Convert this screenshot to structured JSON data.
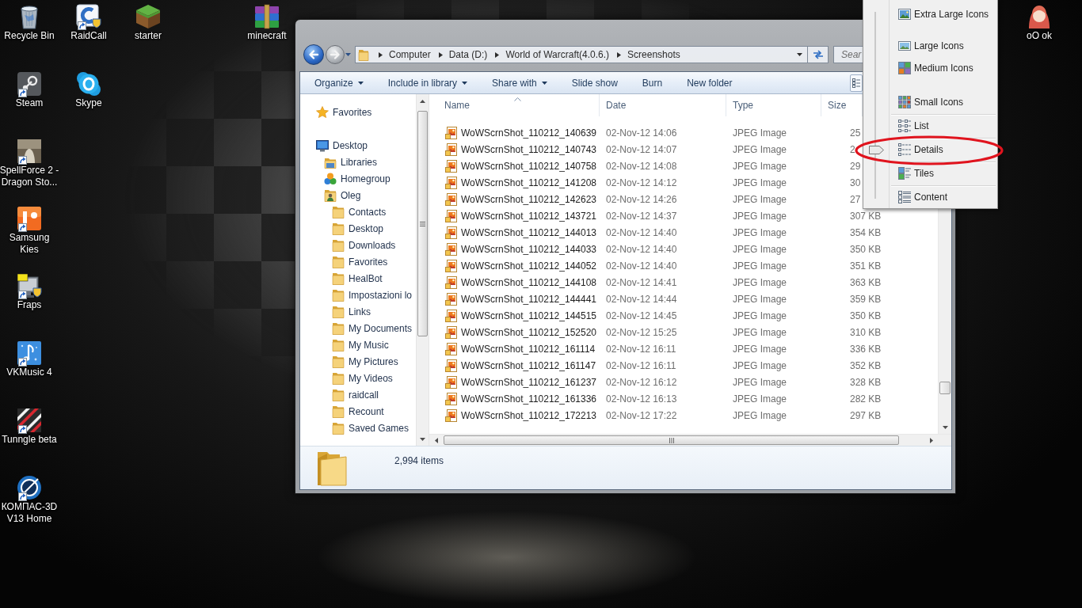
{
  "desktop_icons": [
    {
      "label": "Recycle Bin",
      "shortcut": false
    },
    {
      "label": "RaidCall",
      "shortcut": true
    },
    {
      "label": "starter",
      "shortcut": false
    },
    {
      "label": "minecraft",
      "shortcut": false
    },
    {
      "label": "oO ok",
      "shortcut": false
    },
    {
      "label": "Steam",
      "shortcut": true
    },
    {
      "label": "Skype",
      "shortcut": false
    },
    {
      "label": "SpellForce 2 - Dragon Sto...",
      "shortcut": true
    },
    {
      "label": "Samsung Kies",
      "shortcut": true
    },
    {
      "label": "Fraps",
      "shortcut": true
    },
    {
      "label": "VKMusic 4",
      "shortcut": true
    },
    {
      "label": "Tunngle beta",
      "shortcut": true
    },
    {
      "label": "КОМПАС-3D V13 Home",
      "shortcut": true
    }
  ],
  "explorer": {
    "nav_buttons": [
      {
        "kind": "back",
        "disabled": false
      },
      {
        "kind": "forward",
        "disabled": true
      }
    ],
    "address_bar": {
      "path": [
        "Computer",
        "Data (D:)",
        "World of Warcraft(4.0.6.)",
        "Screenshots"
      ]
    },
    "search": {
      "placeholder": "Sear"
    },
    "toolbar": [
      {
        "label": "Organize",
        "menu": true
      },
      {
        "label": "Include in library",
        "menu": true
      },
      {
        "label": "Share with",
        "menu": true
      },
      {
        "label": "Slide show",
        "menu": false
      },
      {
        "label": "Burn",
        "menu": false
      },
      {
        "label": "New folder",
        "menu": false
      }
    ],
    "nav_pane": [
      {
        "label": "Favorites",
        "kind": "favorites"
      },
      {
        "label": "Desktop",
        "kind": "desktop",
        "children": [
          {
            "label": "Libraries",
            "kind": "libraries"
          },
          {
            "label": "Homegroup",
            "kind": "homegroup"
          },
          {
            "label": "Oleg",
            "kind": "user",
            "children": [
              {
                "label": "Contacts",
                "kind": "folder"
              },
              {
                "label": "Desktop",
                "kind": "folder"
              },
              {
                "label": "Downloads",
                "kind": "folder"
              },
              {
                "label": "Favorites",
                "kind": "folder"
              },
              {
                "label": "HealBot",
                "kind": "folder"
              },
              {
                "label": "Impostazioni lo",
                "kind": "folder"
              },
              {
                "label": "Links",
                "kind": "folder"
              },
              {
                "label": "My Documents",
                "kind": "folder"
              },
              {
                "label": "My Music",
                "kind": "folder"
              },
              {
                "label": "My Pictures",
                "kind": "folder"
              },
              {
                "label": "My Videos",
                "kind": "folder"
              },
              {
                "label": "raidcall",
                "kind": "folder"
              },
              {
                "label": "Recount",
                "kind": "folder"
              },
              {
                "label": "Saved Games",
                "kind": "folder"
              }
            ]
          }
        ]
      }
    ],
    "table": {
      "columns": [
        {
          "label": "Name",
          "sorted": true
        },
        {
          "label": "Date",
          "sorted": false
        },
        {
          "label": "Type",
          "sorted": false
        },
        {
          "label": "Size",
          "sorted": false
        }
      ],
      "rows": [
        {
          "name": "WoWScrnShot_110212_140639",
          "date": "02-Nov-12 14:06",
          "type": "JPEG Image",
          "size": "25"
        },
        {
          "name": "WoWScrnShot_110212_140743",
          "date": "02-Nov-12 14:07",
          "type": "JPEG Image",
          "size": "2"
        },
        {
          "name": "WoWScrnShot_110212_140758",
          "date": "02-Nov-12 14:08",
          "type": "JPEG Image",
          "size": "29"
        },
        {
          "name": "WoWScrnShot_110212_141208",
          "date": "02-Nov-12 14:12",
          "type": "JPEG Image",
          "size": "30"
        },
        {
          "name": "WoWScrnShot_110212_142623",
          "date": "02-Nov-12 14:26",
          "type": "JPEG Image",
          "size": "27"
        },
        {
          "name": "WoWScrnShot_110212_143721",
          "date": "02-Nov-12 14:37",
          "type": "JPEG Image",
          "size": "307 KB"
        },
        {
          "name": "WoWScrnShot_110212_144013",
          "date": "02-Nov-12 14:40",
          "type": "JPEG Image",
          "size": "354 KB"
        },
        {
          "name": "WoWScrnShot_110212_144033",
          "date": "02-Nov-12 14:40",
          "type": "JPEG Image",
          "size": "350 KB"
        },
        {
          "name": "WoWScrnShot_110212_144052",
          "date": "02-Nov-12 14:40",
          "type": "JPEG Image",
          "size": "351 KB"
        },
        {
          "name": "WoWScrnShot_110212_144108",
          "date": "02-Nov-12 14:41",
          "type": "JPEG Image",
          "size": "363 KB"
        },
        {
          "name": "WoWScrnShot_110212_144441",
          "date": "02-Nov-12 14:44",
          "type": "JPEG Image",
          "size": "359 KB"
        },
        {
          "name": "WoWScrnShot_110212_144515",
          "date": "02-Nov-12 14:45",
          "type": "JPEG Image",
          "size": "350 KB"
        },
        {
          "name": "WoWScrnShot_110212_152520",
          "date": "02-Nov-12 15:25",
          "type": "JPEG Image",
          "size": "310 KB"
        },
        {
          "name": "WoWScrnShot_110212_161114",
          "date": "02-Nov-12 16:11",
          "type": "JPEG Image",
          "size": "336 KB"
        },
        {
          "name": "WoWScrnShot_110212_161147",
          "date": "02-Nov-12 16:11",
          "type": "JPEG Image",
          "size": "352 KB"
        },
        {
          "name": "WoWScrnShot_110212_161237",
          "date": "02-Nov-12 16:12",
          "type": "JPEG Image",
          "size": "328 KB"
        },
        {
          "name": "WoWScrnShot_110212_161336",
          "date": "02-Nov-12 16:13",
          "type": "JPEG Image",
          "size": "282 KB"
        },
        {
          "name": "WoWScrnShot_110212_172213",
          "date": "02-Nov-12 17:22",
          "type": "JPEG Image",
          "size": "297 KB"
        }
      ]
    },
    "status": {
      "item_count": "2,994 items"
    }
  },
  "views_menu": {
    "items": [
      {
        "label": "Extra Large Icons",
        "kind": "extra_large",
        "selected": false
      },
      {
        "label": "Large Icons",
        "kind": "large",
        "selected": false
      },
      {
        "label": "Medium Icons",
        "kind": "medium",
        "selected": false
      },
      {
        "label": "Small Icons",
        "kind": "small",
        "selected": false
      },
      {
        "label": "List",
        "kind": "list",
        "selected": false
      },
      {
        "label": "Details",
        "kind": "details",
        "selected": true
      },
      {
        "label": "Tiles",
        "kind": "tiles",
        "selected": false
      },
      {
        "label": "Content",
        "kind": "content",
        "selected": false
      }
    ]
  },
  "annotation": {
    "kind": "ellipse"
  }
}
